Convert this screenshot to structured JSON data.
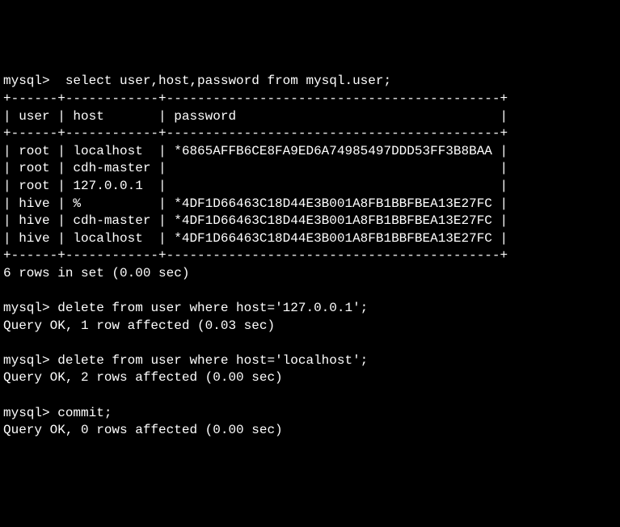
{
  "prompt": "mysql>",
  "queries": {
    "select": " select user,host,password from mysql.user;",
    "delete1": "delete from user where host='127.0.0.1';",
    "delete2": "delete from user where host='localhost';",
    "commit": "commit;"
  },
  "table": {
    "border_top": "+------+------------+-------------------------------------------+",
    "header_row": "| user | host       | password                                  |",
    "rows": [
      "| root | localhost  | *6865AFFB6CE8FA9ED6A74985497DDD53FF3B8BAA |",
      "| root | cdh-master |                                           |",
      "| root | 127.0.0.1  |                                           |",
      "| hive | %          | *4DF1D66463C18D44E3B001A8FB1BBFBEA13E27FC |",
      "| hive | cdh-master | *4DF1D66463C18D44E3B001A8FB1BBFBEA13E27FC |",
      "| hive | localhost  | *4DF1D66463C18D44E3B001A8FB1BBFBEA13E27FC |"
    ]
  },
  "results": {
    "select_summary": "6 rows in set (0.00 sec)",
    "delete1_result": "Query OK, 1 row affected (0.03 sec)",
    "delete2_result": "Query OK, 2 rows affected (0.00 sec)",
    "commit_result": "Query OK, 0 rows affected (0.00 sec)"
  }
}
